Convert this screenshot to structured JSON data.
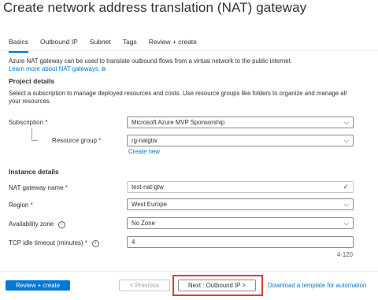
{
  "header": {
    "title": "Create network address translation (NAT) gateway",
    "more": "···"
  },
  "tabs": [
    {
      "label": "Basics"
    },
    {
      "label": "Outbound IP"
    },
    {
      "label": "Subnet"
    },
    {
      "label": "Tags"
    },
    {
      "label": "Review + create"
    }
  ],
  "intro": {
    "text": "Azure NAT gateway can be used to translate outbound flows from a virtual network to the public internet.",
    "link": "Learn more about NAT gateways."
  },
  "project": {
    "heading": "Project details",
    "description_line1": "Select a subscription to manage deployed resources and costs. Use resource groups like folders to organize and manage all",
    "description_line2": "your resources.",
    "subscription_label": "Subscription",
    "subscription_value": "Microsoft Azure MVP Sponsorship",
    "resource_group_label": "Resource group",
    "resource_group_value": "rg-natgtw",
    "create_new": "Create new"
  },
  "instance": {
    "heading": "Instance details",
    "name_label": "NAT gateway name",
    "name_value": "test-nat-gtw",
    "region_label": "Region",
    "region_value": "West Europe",
    "zone_label": "Availability zone",
    "zone_value": "No Zone",
    "timeout_label": "TCP idle timeout (minutes)",
    "timeout_value": "4",
    "timeout_range": "4-120"
  },
  "required_marker": "*",
  "footer": {
    "review_create": "Review + create",
    "previous": "< Previous",
    "next": "Next : Outbound IP >",
    "download": "Download a template for automation"
  },
  "colors": {
    "accent": "#0078d4",
    "highlight": "#e03b3b",
    "required": "#a4262c",
    "valid": "#107c10"
  }
}
